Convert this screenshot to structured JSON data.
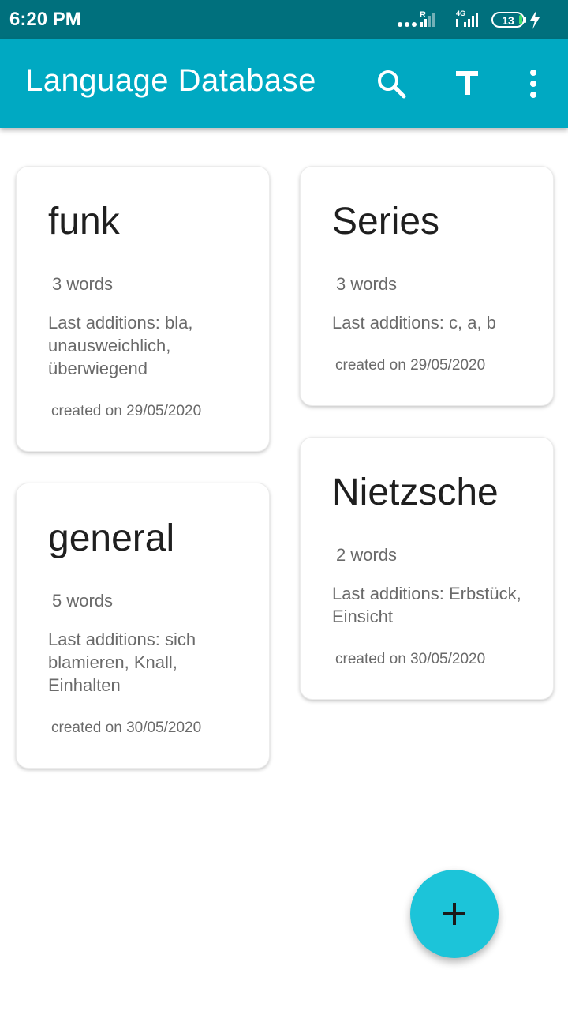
{
  "status_bar": {
    "time": "6:20 PM",
    "roaming_label": "R",
    "network_label": "4G",
    "battery_level": "13",
    "icons": [
      "dots-icon",
      "signal-icon",
      "signal-4g-icon",
      "battery-icon",
      "charging-icon"
    ]
  },
  "app_bar": {
    "title": "Language Database",
    "actions": [
      "search-icon",
      "text-format-icon",
      "more-vert-icon"
    ]
  },
  "colors": {
    "status_bar": "#00707d",
    "app_bar": "#00a9c2",
    "fab": "#1cc4d9"
  },
  "databases": [
    {
      "title": "funk",
      "word_count": "3 words",
      "last_additions": "Last additions: bla, unausweichlich, überwiegend",
      "created": "created on 29/05/2020"
    },
    {
      "title": "Series",
      "word_count": "3 words",
      "last_additions": "Last additions: c, a, b",
      "created": "created on 29/05/2020"
    },
    {
      "title": "general",
      "word_count": "5 words",
      "last_additions": "Last additions: sich blamieren, Knall, Einhalten",
      "created": "created on 30/05/2020"
    },
    {
      "title": "Nietzsche",
      "word_count": "2 words",
      "last_additions": "Last additions: Erbstück, Einsicht",
      "created": "created on 30/05/2020"
    }
  ],
  "fab": {
    "icon": "add-icon"
  }
}
